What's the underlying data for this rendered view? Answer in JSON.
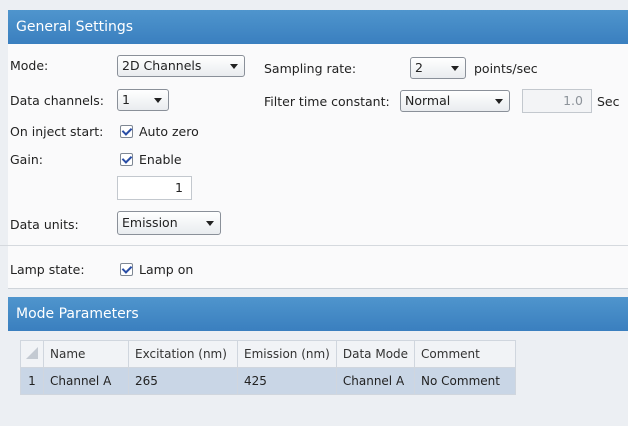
{
  "general": {
    "header": "General Settings",
    "mode_label": "Mode:",
    "mode_value": "2D Channels",
    "channels_label": "Data channels:",
    "channels_value": "1",
    "inject_label": "On inject start:",
    "auto_zero_label": "Auto zero",
    "auto_zero_checked": true,
    "gain_label": "Gain:",
    "gain_enable_label": "Enable",
    "gain_enable_checked": true,
    "gain_value": "1",
    "units_label": "Data units:",
    "units_value": "Emission",
    "sampling_label": "Sampling rate:",
    "sampling_value": "2",
    "sampling_unit": "points/sec",
    "filter_label": "Filter time constant:",
    "filter_value": "Normal",
    "filter_number": "1.0",
    "filter_unit": "Sec",
    "lamp_label": "Lamp state:",
    "lamp_on_label": "Lamp on",
    "lamp_on_checked": true
  },
  "mode_params": {
    "header": "Mode Parameters",
    "columns": [
      "Name",
      "Excitation (nm)",
      "Emission (nm)",
      "Data Mode",
      "Comment"
    ],
    "rows": [
      {
        "index": "1",
        "name": "Channel A",
        "excitation": "265",
        "emission": "425",
        "data_mode": "Channel A",
        "comment": "No Comment"
      }
    ]
  },
  "colors": {
    "header_blue": "#3f86c6",
    "selected_row": "#c9d6e6",
    "check_mark": "#2a4ea6"
  }
}
